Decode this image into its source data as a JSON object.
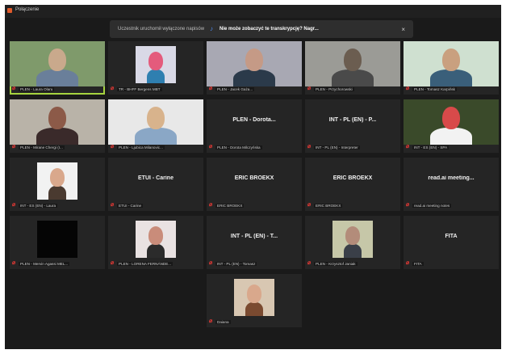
{
  "app": {
    "title": "Połączenie",
    "icon": "app-icon",
    "accent_color": "#a6d33f",
    "muted_color": "#e53935"
  },
  "banner": {
    "text": "Uczestnik uruchomił wyłączone napisów",
    "icon": "captions-icon",
    "link": "Nie może zobaczyć te transkrypcję? Nagr...",
    "close": "×"
  },
  "tiles": [
    {
      "name": "PLEN - Laura Olaru",
      "title": "",
      "video": true,
      "active": true
    },
    {
      "name": "TR - BHFF Bergens MBT",
      "title": "",
      "video": true
    },
    {
      "name": "PLEN - Jacek Gaża...",
      "title": "",
      "video": true
    },
    {
      "name": "PLEN - Przychorowski",
      "title": "",
      "video": true
    },
    {
      "name": "PLEN - Tomasz Karpińsk",
      "title": "",
      "video": true
    },
    {
      "name": "PLEN - Mirane Chergi (I...",
      "title": "",
      "video": true
    },
    {
      "name": "PLEN - Ljubica Milanovic...",
      "title": "",
      "video": true
    },
    {
      "name": "PLEN - Dorota Milczyńska",
      "title": "PLEN - Dorota...",
      "video": false
    },
    {
      "name": "INT - PL (EN) - Interpreter",
      "title": "INT - PL (EN) - P...",
      "video": false
    },
    {
      "name": "INT - ES (EN) - SPA",
      "title": "",
      "video": true
    },
    {
      "name": "INT - ES (EN) - Laura",
      "title": "",
      "video": true
    },
    {
      "name": "ETUI - Carine",
      "title": "ETUI - Carine",
      "video": false
    },
    {
      "name": "ERIC BROEKX",
      "title": "ERIC BROEKX",
      "video": false
    },
    {
      "name": "ERIC BROEKX",
      "title": "ERIC BROEKX",
      "video": false
    },
    {
      "name": "read.ai meeting notes",
      "title": "read.ai meeting...",
      "video": false
    },
    {
      "name": "PLEN - Mervin Agassi MEL...",
      "title": "",
      "video": true
    },
    {
      "name": "PLEN - LORENA FERNÁNDE...",
      "title": "",
      "video": true
    },
    {
      "name": "INT - PL (EN) - Tomasz",
      "title": "INT - PL (EN) - T...",
      "video": false
    },
    {
      "name": "PLEN - Krzysztof Janiak",
      "title": "",
      "video": true
    },
    {
      "name": "FITA",
      "title": "FITA",
      "video": false
    },
    {
      "name": "Daiana",
      "title": "",
      "video": true
    }
  ]
}
